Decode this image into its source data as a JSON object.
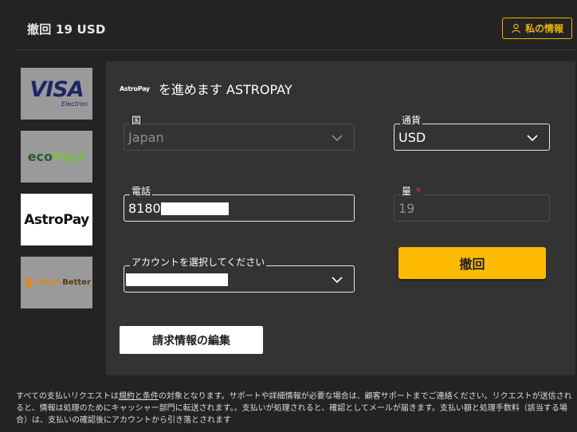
{
  "header": {
    "title": "撤回 19 USD",
    "profile_label": "私の情報"
  },
  "payment_methods": [
    {
      "name": "VISA",
      "sub": "Electron",
      "active": false
    },
    {
      "name_a": "eco",
      "name_b": "Payz",
      "active": false
    },
    {
      "name": "AstroPay",
      "active": true
    },
    {
      "name_a": "Much",
      "name_b": "Better",
      "active": false
    }
  ],
  "panel": {
    "logo_text": "AstroPay",
    "title": "を進めます ASTROPAY",
    "country": {
      "label": "国",
      "value": "Japan"
    },
    "currency": {
      "label": "通貨",
      "value": "USD"
    },
    "phone": {
      "label": "電話",
      "value": "8180"
    },
    "amount": {
      "label": "量",
      "required_mark": "*",
      "value": "19"
    },
    "account": {
      "label": "アカウントを選択してください"
    },
    "submit_label": "撤回",
    "edit_label": "請求情報の編集"
  },
  "footer": {
    "part1": "すべての支払いリクエストは",
    "terms_link": "規約と条件",
    "part2": "の対象となります。サポートや詳細情報が必要な場合は、顧客サポートまでご連絡ください。リクエストが送信されると、情報は処理のためにキャッシャー部門に転送されます。。支払いが処理されると、確認としてメールが届きます。支払い額と処理手数料（該当する場合）は、支払いの確認後にアカウントから引き落とされます"
  },
  "colors": {
    "accent": "#ffbb00",
    "background": "#232323",
    "panel": "#333333"
  }
}
